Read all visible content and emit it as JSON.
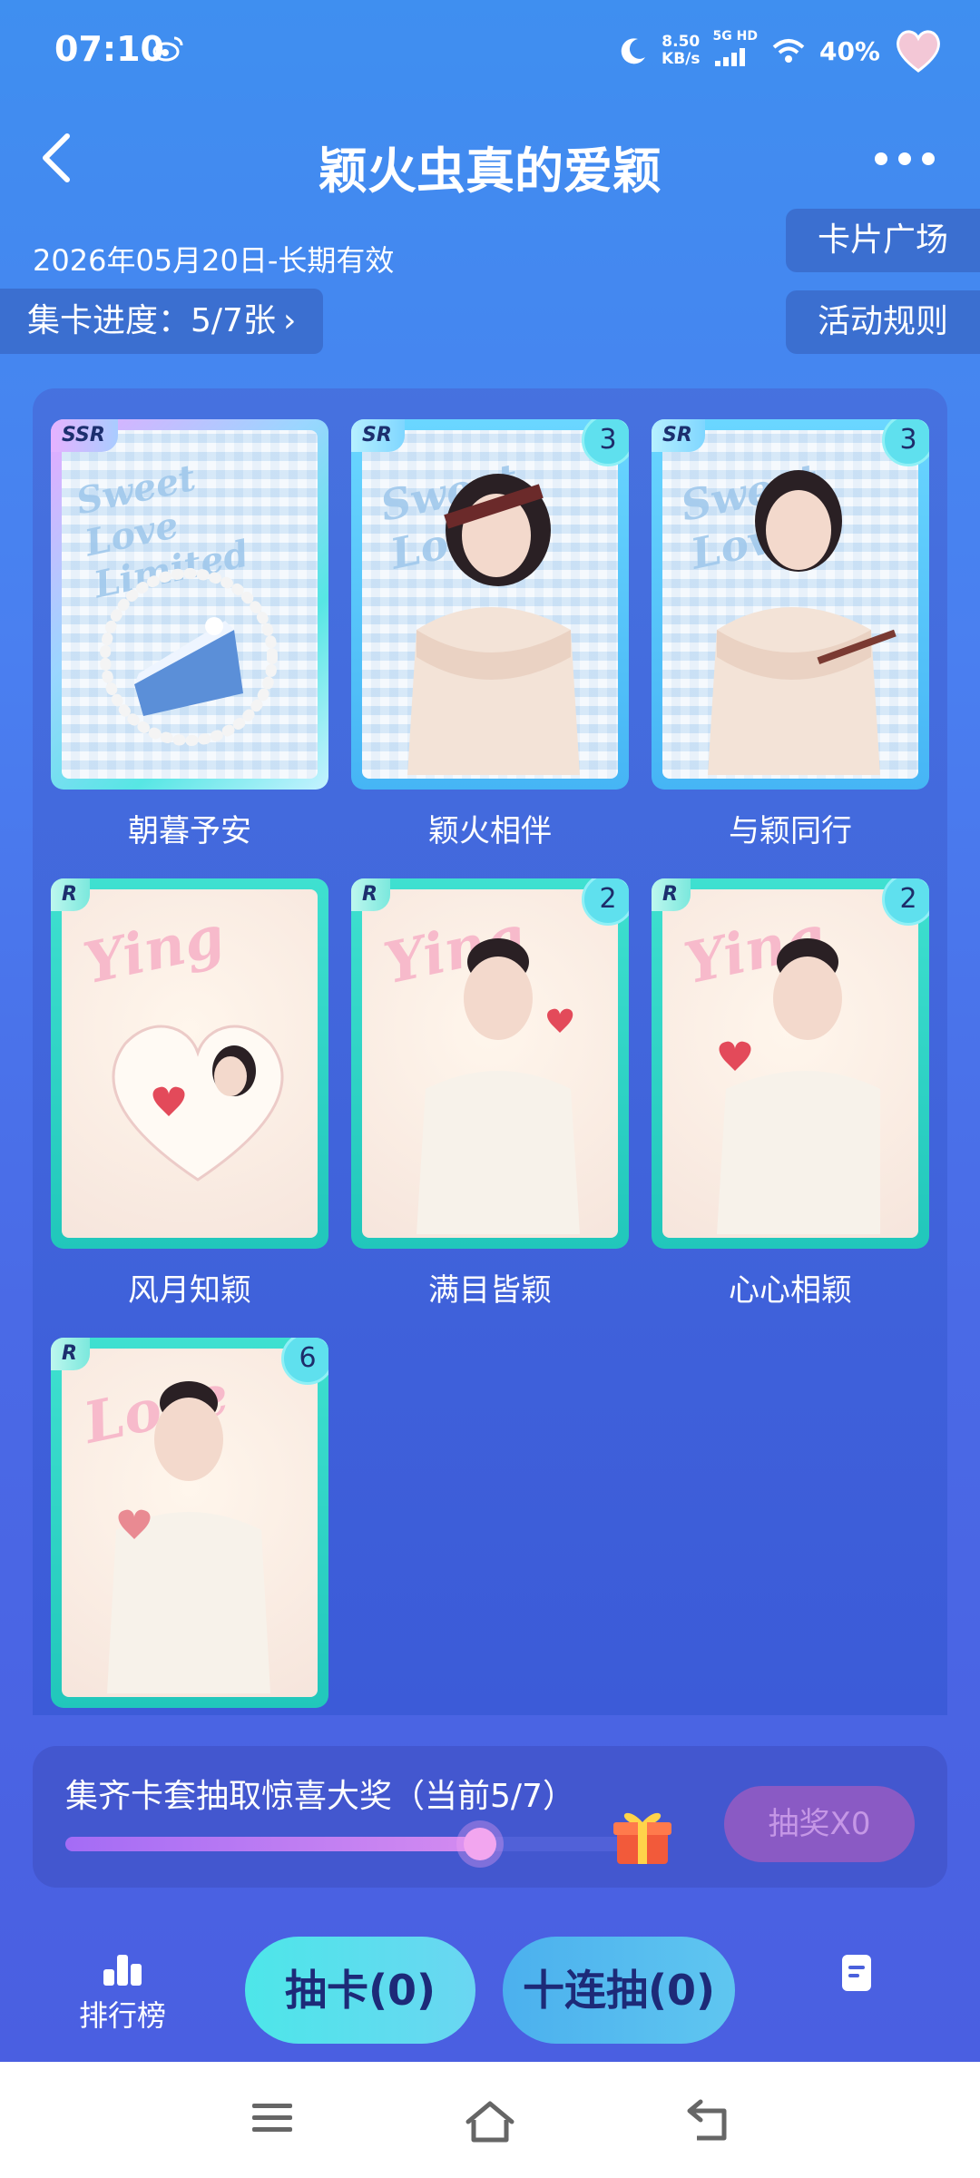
{
  "status": {
    "time": "07:10",
    "net_speed_value": "8.50",
    "net_speed_unit": "KB/s",
    "signal_label": "5G HD",
    "battery": "40%",
    "icons": [
      "weibo-icon",
      "moon-icon",
      "signal-icon",
      "wifi-icon",
      "heart-avatar-icon"
    ]
  },
  "header": {
    "title": "颖火虫真的爱颖",
    "back_icon": "back-arrow-icon",
    "more_icon": "more-dots-icon"
  },
  "validity": "2026年05月20日-长期有效",
  "progress_chip": {
    "label": "集卡进度：5/7张",
    "chevron": "›"
  },
  "chips": {
    "plaza": "卡片广场",
    "rules": "活动规则"
  },
  "cards": [
    {
      "name": "朝暮予安",
      "rarity": "SSR",
      "count": "",
      "deco": "Sweet Love Limited"
    },
    {
      "name": "颖火相伴",
      "rarity": "SR",
      "count": "3",
      "deco": "Sweet Love"
    },
    {
      "name": "与颖同行",
      "rarity": "SR",
      "count": "3",
      "deco": "Sweet Love"
    },
    {
      "name": "风月知颖",
      "rarity": "R",
      "count": "",
      "deco": "Ying"
    },
    {
      "name": "满目皆颖",
      "rarity": "R",
      "count": "2",
      "deco": "Ying"
    },
    {
      "name": "心心相颖",
      "rarity": "R",
      "count": "2",
      "deco": "Ying"
    },
    {
      "name": "",
      "rarity": "R",
      "count": "6",
      "deco": "Love"
    }
  ],
  "reward": {
    "text": "集齐卡套抽取惊喜大奖（当前5/7）",
    "progress_fraction": 0.714,
    "button": "抽奖X0",
    "gift_icon": "gift-box-icon"
  },
  "nav": {
    "rank_label": "排行榜",
    "draw_label": "抽卡(0)",
    "ten_draw_label": "十连抽(0)",
    "doc_icon": "document-icon"
  },
  "colors": {
    "accent_cyan": "#4de6e9",
    "bg_blue": "#4a6ae6",
    "count_badge": "#5fe0ee"
  }
}
